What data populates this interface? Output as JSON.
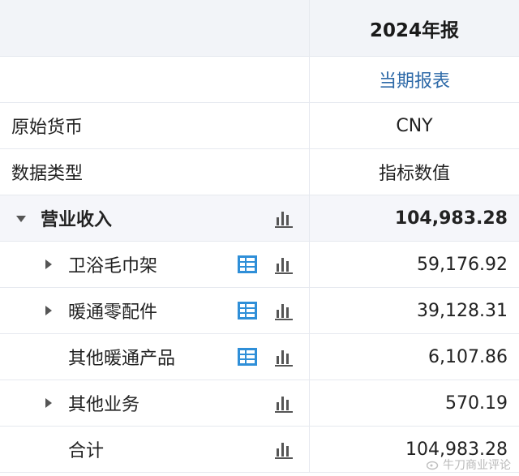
{
  "header": {
    "period": "2024年报",
    "report_link": "当期报表"
  },
  "rows": [
    {
      "label": "原始货币",
      "value": "CNY"
    },
    {
      "label": "数据类型",
      "value": "指标数值"
    },
    {
      "label": "营业收入",
      "value": "104,983.28"
    },
    {
      "label": "卫浴毛巾架",
      "value": "59,176.92"
    },
    {
      "label": "暖通零配件",
      "value": "39,128.31"
    },
    {
      "label": "其他暖通产品",
      "value": "6,107.86"
    },
    {
      "label": "其他业务",
      "value": "570.19"
    },
    {
      "label": "合计",
      "value": "104,983.28"
    }
  ],
  "watermark": "牛刀商业评论",
  "icons": {
    "chart": "bar-chart-icon",
    "detail": "table-detail-icon",
    "expand": "caret-right-icon",
    "collapse": "caret-down-icon"
  },
  "colors": {
    "header_bg": "#f2f4f8",
    "link": "#2e6aa8",
    "detail_icon": "#2f8fd8",
    "chart_icon": "#555555"
  }
}
